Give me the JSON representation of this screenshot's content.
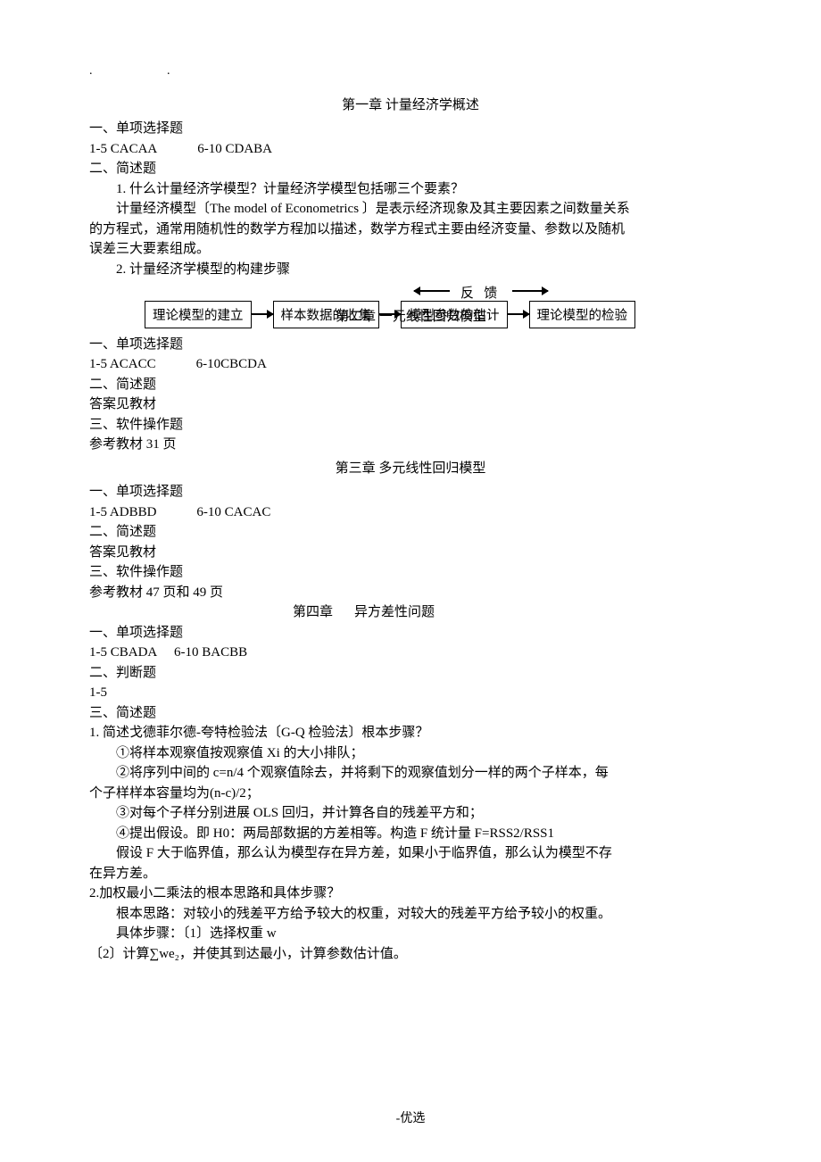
{
  "dots_left": ".",
  "dots_right": ".",
  "ch1": {
    "title": "第一章  计量经济学概述",
    "s1_head": "一、单项选择题",
    "s1_ans": "1-5 CACAA   6-10 CDABA",
    "s2_head": "二、简述题",
    "q1": "1.  什么计量经济学模型？计量经济学模型包括哪三个要素？",
    "a1_p1": "计量经济模型〔The model of Econometrics 〕是表示经济现象及其主要因素之间数量关系",
    "a1_p2": "的方程式，通常用随机性的数学方程加以描述，数学方程式主要由经济变量、参数以及随机",
    "a1_p3": "误差三大要素组成。",
    "q2": "2.  计量经济学模型的构建步骤",
    "flow": {
      "feedback_l": "反",
      "feedback_r": "馈",
      "b1": "理论模型的建立",
      "b2": "样本数据的收集",
      "b3": "模型参数的估计",
      "b4": "理论模型的检验"
    }
  },
  "ch2": {
    "title_overlay": "第二章  一元线性回归模型",
    "s1_head": "一、单项选择题",
    "s1_ans": "1-5 ACACC   6-10CBCDA",
    "s2_head": "二、简述题",
    "s2_ans": "答案见教材",
    "s3_head": "三、软件操作题",
    "s3_ans": "参考教材 31 页"
  },
  "ch3": {
    "title": "第三章  多元线性回归模型",
    "s1_head": "一、单项选择题",
    "s1_ans": "1-5 ADBBD   6-10 CACAC",
    "s2_head": "二、简述题",
    "s2_ans": "答案见教材",
    "s3_head": "三、软件操作题",
    "s3_ans": "参考教材 47 页和 49 页"
  },
  "ch4": {
    "title_prefix": "第四章",
    "title_text": "异方差性问题",
    "s1_head": "一、单项选择题",
    "s1_ans": "1-5 CBADA  6-10 BACBB",
    "s2_head": "二、判断题",
    "s2_ans": "1-5",
    "s3_head": "三、简述题",
    "q1": "1.  简述戈德菲尔德-夸特检验法〔G-Q 检验法〕根本步骤？",
    "q1_s1": "①将样本观察值按观察值 Xi 的大小排队；",
    "q1_s2": "②将序列中间的  c=n/4  个观察值除去，并将剩下的观察值划分一样的两个子样本，每",
    "q1_s2b": "个子样样本容量均为(n-c)/2；",
    "q1_s3": "③对每个子样分别进展 OLS 回归，并计算各自的残差平方和；",
    "q1_s4": "④提出假设。即 H0：两局部数据的方差相等。构造 F 统计量 F=RSS2/RSS1",
    "q1_p1": "假设 F 大于临界值，那么认为模型存在异方差，如果小于临界值，那么认为模型不存",
    "q1_p2": "在异方差。",
    "q2": "2.加权最小二乘法的根本思路和具体步骤？",
    "q2_p1": "根本思路：对较小的残差平方给予较大的权重，对较大的残差平方给予较小的权重。",
    "q2_p2": "具体步骤：〔1〕选择权重 w",
    "q2_p3": "〔2〕计算∑we₂，并使其到达最小，计算参数估计值。"
  },
  "footer": "-优选"
}
